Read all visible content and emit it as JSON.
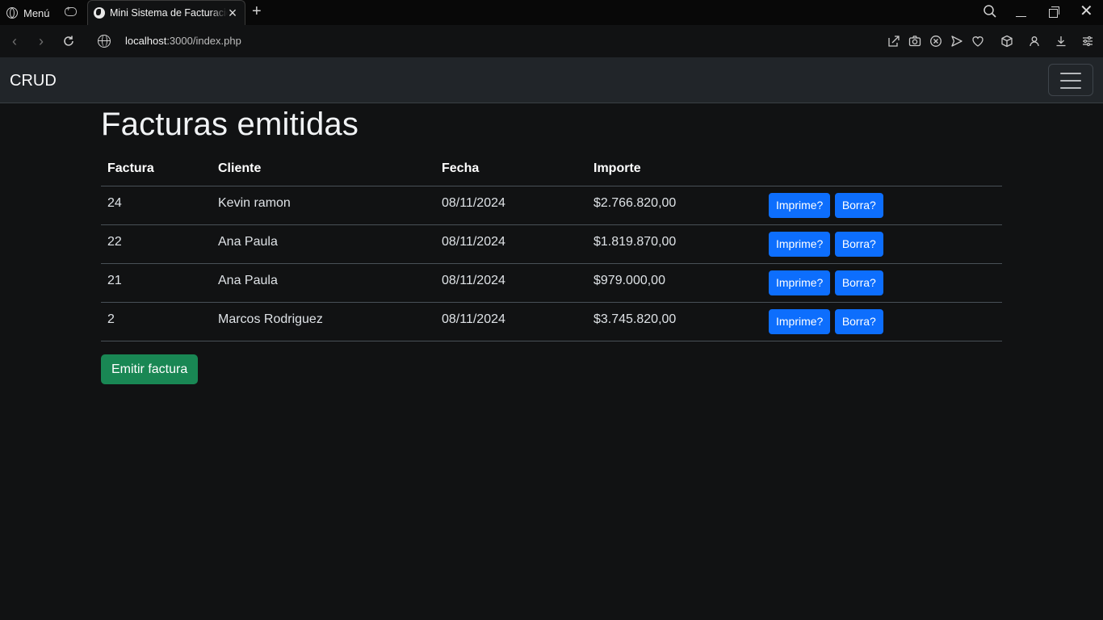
{
  "browser": {
    "menu_label": "Menú",
    "tab_title": "Mini Sistema de Facturación",
    "url_host": "localhost",
    "url_path": ":3000/index.php"
  },
  "navbar": {
    "brand": "CRUD"
  },
  "page": {
    "title": "Facturas emitidas",
    "columns": [
      "Factura",
      "Cliente",
      "Fecha",
      "Importe"
    ],
    "rows": [
      {
        "factura": "24",
        "cliente": "Kevin ramon",
        "fecha": "08/11/2024",
        "importe": "$2.766.820,00"
      },
      {
        "factura": "22",
        "cliente": "Ana Paula",
        "fecha": "08/11/2024",
        "importe": "$1.819.870,00"
      },
      {
        "factura": "21",
        "cliente": "Ana Paula",
        "fecha": "08/11/2024",
        "importe": "$979.000,00"
      },
      {
        "factura": "2",
        "cliente": "Marcos Rodriguez",
        "fecha": "08/11/2024",
        "importe": "$3.745.820,00"
      }
    ],
    "print_label": "Imprime?",
    "delete_label": "Borra?",
    "emit_label": "Emitir factura"
  },
  "colors": {
    "primary": "#0d6efd",
    "success": "#198754",
    "navbar_bg": "#212529",
    "page_bg": "#111213"
  }
}
